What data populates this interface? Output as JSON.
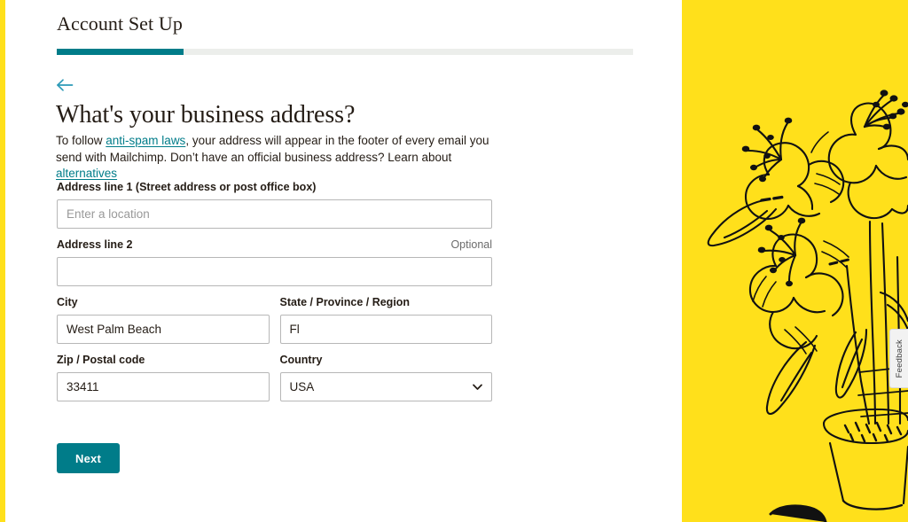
{
  "brand": {
    "teal": "#007c89",
    "teal_link": "#007c89",
    "arrow_teal": "#2c9ab7",
    "yellow": "#ffe01b",
    "track_gray": "#eceeeb",
    "border_gray": "#b7b7b7"
  },
  "setup": {
    "title": "Account Set Up",
    "progress_percent": 22
  },
  "nav": {
    "back_label": "Back",
    "back_icon": "arrow-left-icon"
  },
  "main": {
    "heading": "What's your business address?",
    "intro": {
      "part1": "To follow ",
      "link1": "anti-spam laws",
      "part2": ", your address will appear in the footer of every email you send with Mailchimp. Don’t have an official business address? Learn about ",
      "link2": "alternatives"
    }
  },
  "form": {
    "address1": {
      "label": "Address line 1 (Street address or post office box)",
      "placeholder": "Enter a location",
      "value": ""
    },
    "address2": {
      "label": "Address line 2",
      "optional_tag": "Optional",
      "placeholder": "",
      "value": ""
    },
    "city": {
      "label": "City",
      "value": "West Palm Beach"
    },
    "state": {
      "label": "State / Province / Region",
      "value": "Fl"
    },
    "zip": {
      "label": "Zip / Postal code",
      "value": "33411"
    },
    "country": {
      "label": "Country",
      "value": "USA",
      "chevron_icon": "chevron-down-icon",
      "options": [
        "USA"
      ]
    },
    "submit_label": "Next"
  },
  "feedback": {
    "label": "Feedback"
  },
  "illustration": {
    "name": "lily-flowers-in-pot-line-art",
    "background": "#ffe01b",
    "ink": "#111111"
  }
}
